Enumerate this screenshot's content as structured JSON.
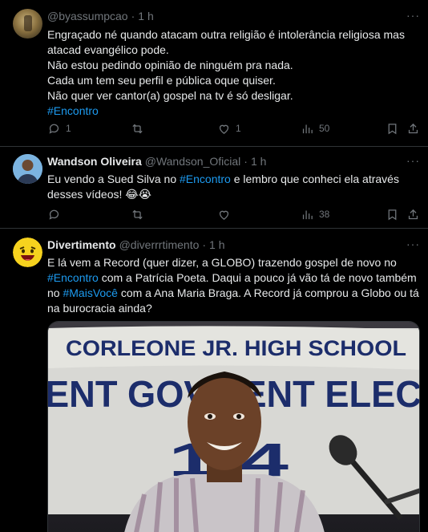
{
  "tweets": [
    {
      "name": "",
      "handle": "@byassumpcao",
      "time": "1 h",
      "lines": [
        "Engraçado né quando atacam outra religião é intolerância religiosa mas",
        "atacad evangélico pode.",
        "Não estou pedindo opinião de ninguém pra nada.",
        "Cada um tem seu perfil e pública oque quiser.",
        "Não quer ver cantor(a) gospel na tv é só desligar."
      ],
      "hashtag": "#Encontro",
      "replies": "1",
      "retweets": "",
      "likes": "1",
      "views": "50"
    },
    {
      "name": "Wandson Oliveira",
      "handle": "@Wandson_Oficial",
      "time": "1 h",
      "line1_pre": "Eu vendo a Sued Silva no ",
      "line1_tag": "#Encontro",
      "line1_post": " e lembro que conheci ela através",
      "line2": "desses vídeos! 😂😭",
      "replies": "",
      "retweets": "",
      "likes": "",
      "views": "38"
    },
    {
      "name": "Divertimento",
      "handle": "@diverrrtimento",
      "time": "1 h",
      "line1": "E lá vem a Record (quer dizer, a GLOBO) trazendo gospel de novo no",
      "line2_tag": "#Encontro",
      "line2_post": " com a Patrícia Poeta. Daqui a pouco já vão tá de novo também",
      "line3_pre": "no ",
      "line3_tag": "#MaisVocê",
      "line3_post": " com a Ana Maria Braga. A Record já comprou a Globo ou tá",
      "line4": "na burocracia ainda?",
      "banner_line1": "CORLEONE JR. HIGH SCHOOL",
      "banner_line2": "ENT GOVE    ENT ELEC",
      "banner_year": "1  4"
    }
  ],
  "colors": {
    "accent": "#1d9bf0",
    "muted": "#71767b",
    "border": "#2f3336"
  },
  "dot": "·",
  "more": "···"
}
